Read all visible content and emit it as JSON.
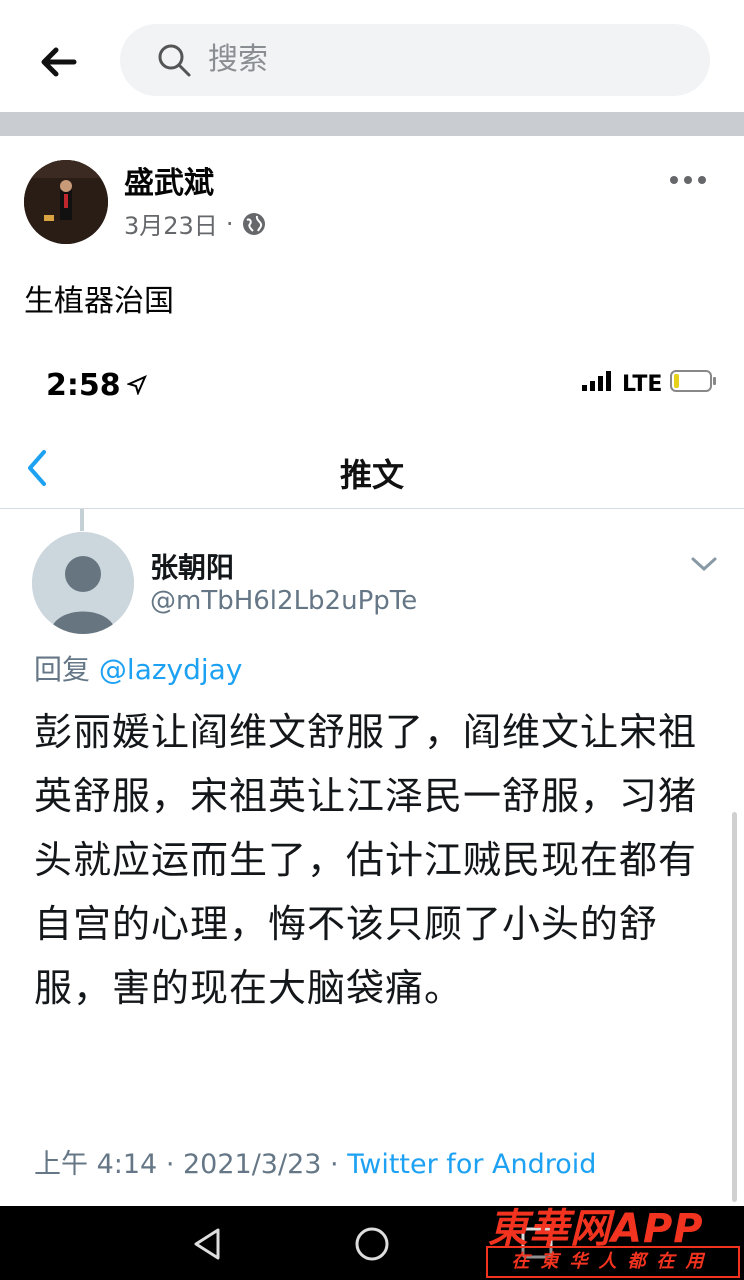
{
  "search": {
    "placeholder": "搜索"
  },
  "post": {
    "author": "盛武斌",
    "date": "3月23日",
    "separator": "·",
    "text": "生植器治国"
  },
  "embed": {
    "status_time": "2:58",
    "network": "LTE",
    "nav_title": "推文",
    "tweet": {
      "name": "张朝阳",
      "handle": "@mTbH6l2Lb2uPpTe",
      "reply_prefix": "回复",
      "reply_mention": "@lazydjay",
      "body": "彭丽媛让阎维文舒服了，阎维文让宋祖英舒服，宋祖英让江泽民一舒服，习猪头就应运而生了，估计江贼民现在都有自宫的心理，悔不该只顾了小头的舒服，害的现在大脑袋痛。",
      "time": "上午 4:14",
      "meta_sep": "·",
      "date": "2021/3/23",
      "client": "Twitter for Android"
    }
  },
  "watermark": {
    "main": "東華网APP",
    "sub": "在東华人都在用"
  },
  "colors": {
    "twitter_blue": "#1da1f2",
    "watermark_red": "#f2331f"
  }
}
